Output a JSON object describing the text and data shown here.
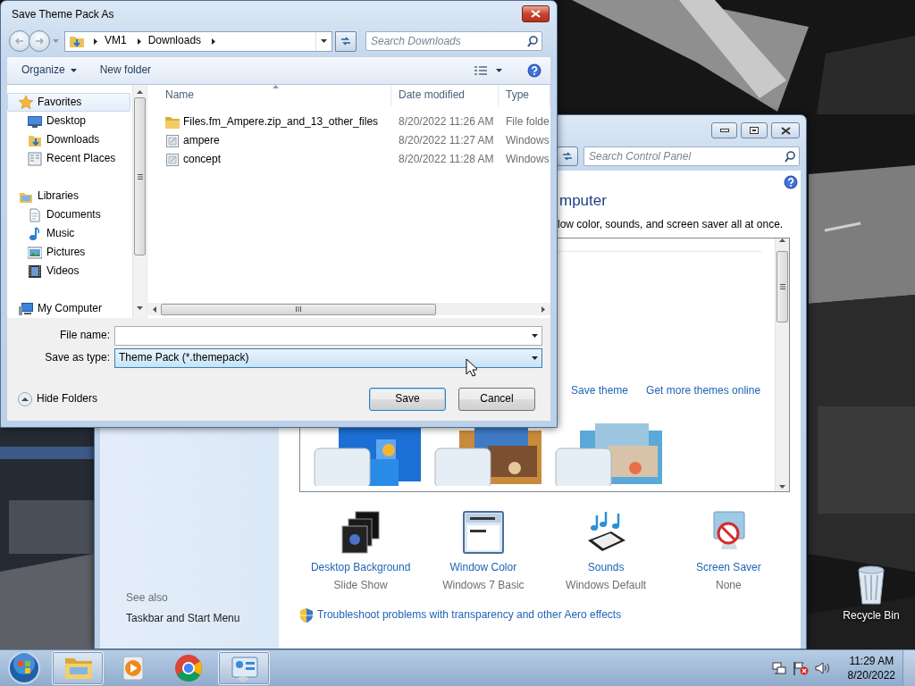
{
  "dialog": {
    "title": "Save Theme Pack As",
    "breadcrumb": [
      "VM1",
      "Downloads"
    ],
    "search": {
      "placeholder": "Search Downloads"
    },
    "toolbar": [
      {
        "label": "Organize",
        "kind": "menu"
      },
      {
        "label": "New folder",
        "kind": "button"
      }
    ],
    "nav_pane": [
      {
        "label": "Favorites",
        "kind": "favorites",
        "selected": true,
        "children": [
          {
            "label": "Desktop",
            "kind": "desktop",
            "selected": false
          },
          {
            "label": "Downloads",
            "kind": "downloads",
            "selected": false
          },
          {
            "label": "Recent Places",
            "kind": "recent",
            "selected": false
          }
        ]
      },
      {
        "label": "Libraries",
        "kind": "libraries",
        "selected": false,
        "children": [
          {
            "label": "Documents",
            "kind": "documents",
            "selected": false
          },
          {
            "label": "Music",
            "kind": "music",
            "selected": false
          },
          {
            "label": "Pictures",
            "kind": "pictures",
            "selected": false
          },
          {
            "label": "Videos",
            "kind": "videos",
            "selected": false
          }
        ]
      },
      {
        "label": "My Computer",
        "kind": "computer",
        "selected": false
      }
    ],
    "columns": [
      "Name",
      "Date modified",
      "Type"
    ],
    "files": [
      {
        "name": "Files.fm_Ampere.zip_and_13_other_files",
        "date": "8/20/2022 11:26 AM",
        "type": "File folde",
        "kind": "folder"
      },
      {
        "name": "ampere",
        "date": "8/20/2022 11:27 AM",
        "type": "Windows",
        "kind": "theme"
      },
      {
        "name": "concept",
        "date": "8/20/2022 11:28 AM",
        "type": "Windows",
        "kind": "theme"
      }
    ],
    "file_name": {
      "label": "File name:"
    },
    "save_as_type": {
      "label": "Save as type:",
      "value": "Theme Pack (*.themepack)"
    },
    "hide_folders": "Hide Folders",
    "buttons": [
      {
        "label": "Save",
        "default": true
      },
      {
        "label": "Cancel",
        "default": false
      }
    ]
  },
  "control_panel": {
    "search": {
      "placeholder": "Search Control Panel"
    },
    "heading": "mputer",
    "description": "low color, sounds, and screen saver all at once.",
    "theme_links": [
      "Save theme",
      "Get more themes online"
    ],
    "theme_previews": [
      {
        "kind": "picture"
      },
      {
        "kind": "picture"
      },
      {
        "kind": "picture"
      }
    ],
    "settings": [
      {
        "label": "Desktop Background",
        "value": "Slide Show",
        "kind": "background"
      },
      {
        "label": "Window Color",
        "value": "Windows 7 Basic",
        "kind": "color"
      },
      {
        "label": "Sounds",
        "value": "Windows Default",
        "kind": "sounds"
      },
      {
        "label": "Screen Saver",
        "value": "None",
        "kind": "screensaver"
      }
    ],
    "see_also": {
      "title": "See also",
      "links": [
        "Taskbar and Start Menu"
      ]
    },
    "troubleshoot_link": "Troubleshoot problems with transparency and other Aero effects"
  },
  "desktop_icons": [
    {
      "label": "Recycle Bin",
      "kind": "recycle"
    }
  ],
  "taskbar": {
    "apps": [
      {
        "kind": "explorer",
        "open": true
      },
      {
        "kind": "media",
        "open": false
      },
      {
        "kind": "chrome",
        "open": false
      },
      {
        "kind": "control_panel",
        "open": true
      }
    ],
    "clock": {
      "time": "11:29 AM",
      "date": "8/20/2022"
    }
  }
}
